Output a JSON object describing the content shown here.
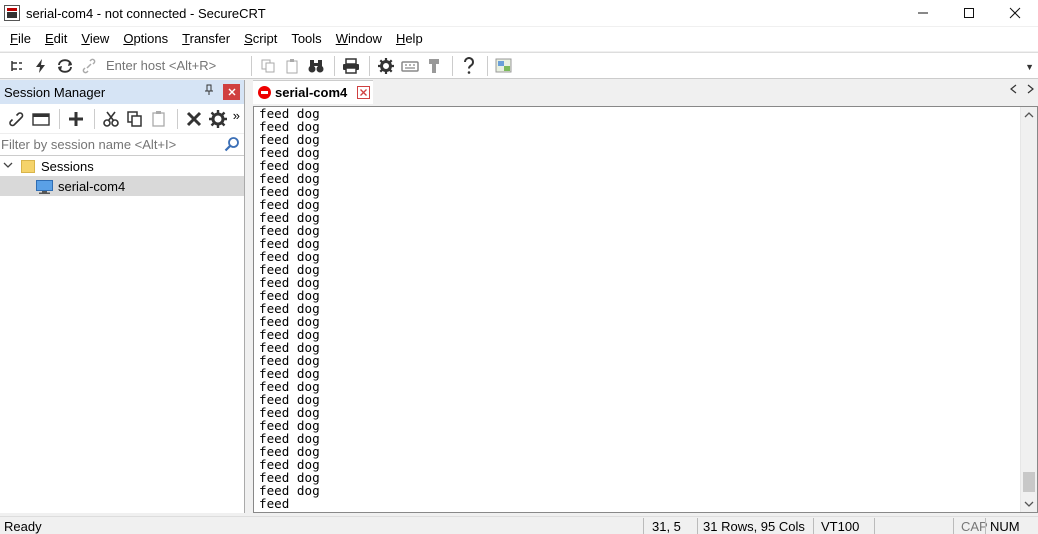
{
  "window": {
    "title": "serial-com4 - not connected - SecureCRT",
    "controls": [
      "minimize-icon",
      "maximize-icon",
      "close-icon"
    ]
  },
  "menu": {
    "items": [
      {
        "label": "File",
        "accel": "F",
        "rest": "ile"
      },
      {
        "label": "Edit",
        "accel": "E",
        "rest": "dit"
      },
      {
        "label": "View",
        "accel": "V",
        "rest": "iew"
      },
      {
        "label": "Options",
        "accel": "O",
        "rest": "ptions"
      },
      {
        "label": "Transfer",
        "accel": "T",
        "rest": "ransfer"
      },
      {
        "label": "Script",
        "accel": "S",
        "rest": "cript"
      },
      {
        "label": "Tools",
        "accel": "",
        "rest": "Tools"
      },
      {
        "label": "Window",
        "accel": "W",
        "rest": "indow"
      },
      {
        "label": "Help",
        "accel": "H",
        "rest": "elp"
      }
    ]
  },
  "toolbar": {
    "host_placeholder": "Enter host <Alt+R>"
  },
  "session_manager": {
    "title": "Session Manager",
    "filter_placeholder": "Filter by session name <Alt+I>",
    "more": "»",
    "tree": {
      "folder_label": "Sessions",
      "session_label": "serial-com4"
    }
  },
  "tab": {
    "label": "serial-com4",
    "close": "x"
  },
  "terminal": {
    "lines": [
      "feed dog",
      "feed dog",
      "feed dog",
      "feed dog",
      "feed dog",
      "feed dog",
      "feed dog",
      "feed dog",
      "feed dog",
      "feed dog",
      "feed dog",
      "feed dog",
      "feed dog",
      "feed dog",
      "feed dog",
      "feed dog",
      "feed dog",
      "feed dog",
      "feed dog",
      "feed dog",
      "feed dog",
      "feed dog",
      "feed dog",
      "feed dog",
      "feed dog",
      "feed dog",
      "feed dog",
      "feed dog",
      "feed dog",
      "feed dog",
      "feed"
    ]
  },
  "status": {
    "ready": "Ready",
    "cursor": "31,  5",
    "size": "31 Rows, 95 Cols",
    "emulation": "VT100",
    "cap": "CAP",
    "num": "NUM"
  },
  "colors": {
    "accent_header": "#d6e4f5",
    "close_red": "#d04040",
    "disconnected_red": "#ee0000"
  }
}
